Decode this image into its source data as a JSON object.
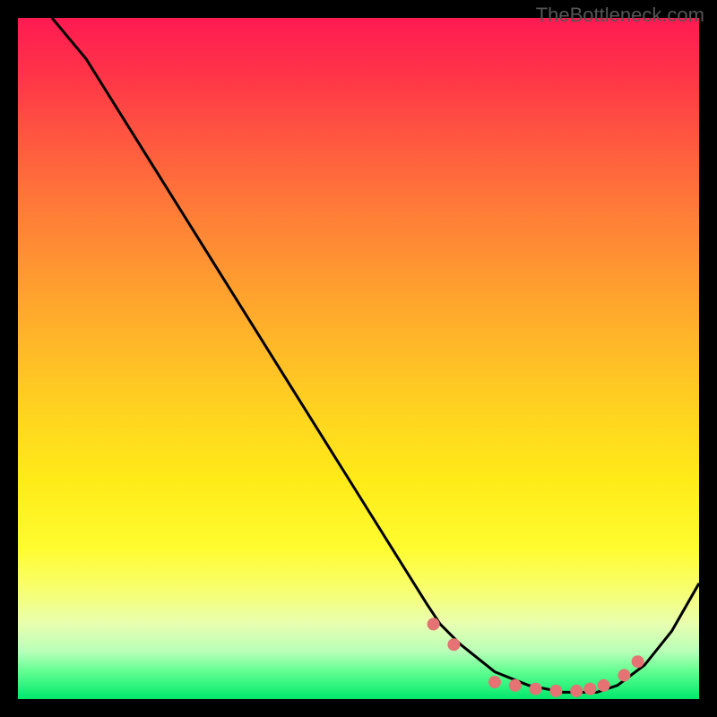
{
  "watermark": "TheBottleneck.com",
  "chart_data": {
    "type": "line",
    "title": "",
    "xlabel": "",
    "ylabel": "",
    "xlim": [
      0,
      100
    ],
    "ylim": [
      0,
      100
    ],
    "series": [
      {
        "name": "curve",
        "x": [
          5,
          10,
          15,
          20,
          25,
          30,
          35,
          40,
          45,
          50,
          55,
          60,
          62,
          65,
          70,
          75,
          80,
          82,
          85,
          88,
          92,
          96,
          100
        ],
        "y": [
          100,
          94,
          86,
          78,
          70,
          62,
          54,
          46,
          38,
          30,
          22,
          14,
          11,
          8,
          4,
          2,
          1,
          1,
          1,
          2,
          5,
          10,
          17
        ]
      }
    ],
    "markers": {
      "name": "dots",
      "x": [
        61,
        64,
        70,
        73,
        76,
        79,
        82,
        84,
        86,
        89,
        91
      ],
      "y": [
        11,
        8,
        2.5,
        2,
        1.5,
        1.2,
        1.2,
        1.5,
        2,
        3.5,
        5.5
      ]
    },
    "gradient_stops": [
      {
        "pos": 0,
        "color": "#ff1a52"
      },
      {
        "pos": 18,
        "color": "#ff5840"
      },
      {
        "pos": 38,
        "color": "#ff9a30"
      },
      {
        "pos": 58,
        "color": "#ffd420"
      },
      {
        "pos": 78,
        "color": "#fffc30"
      },
      {
        "pos": 93,
        "color": "#b8ffb8"
      },
      {
        "pos": 100,
        "color": "#00e86c"
      }
    ]
  }
}
